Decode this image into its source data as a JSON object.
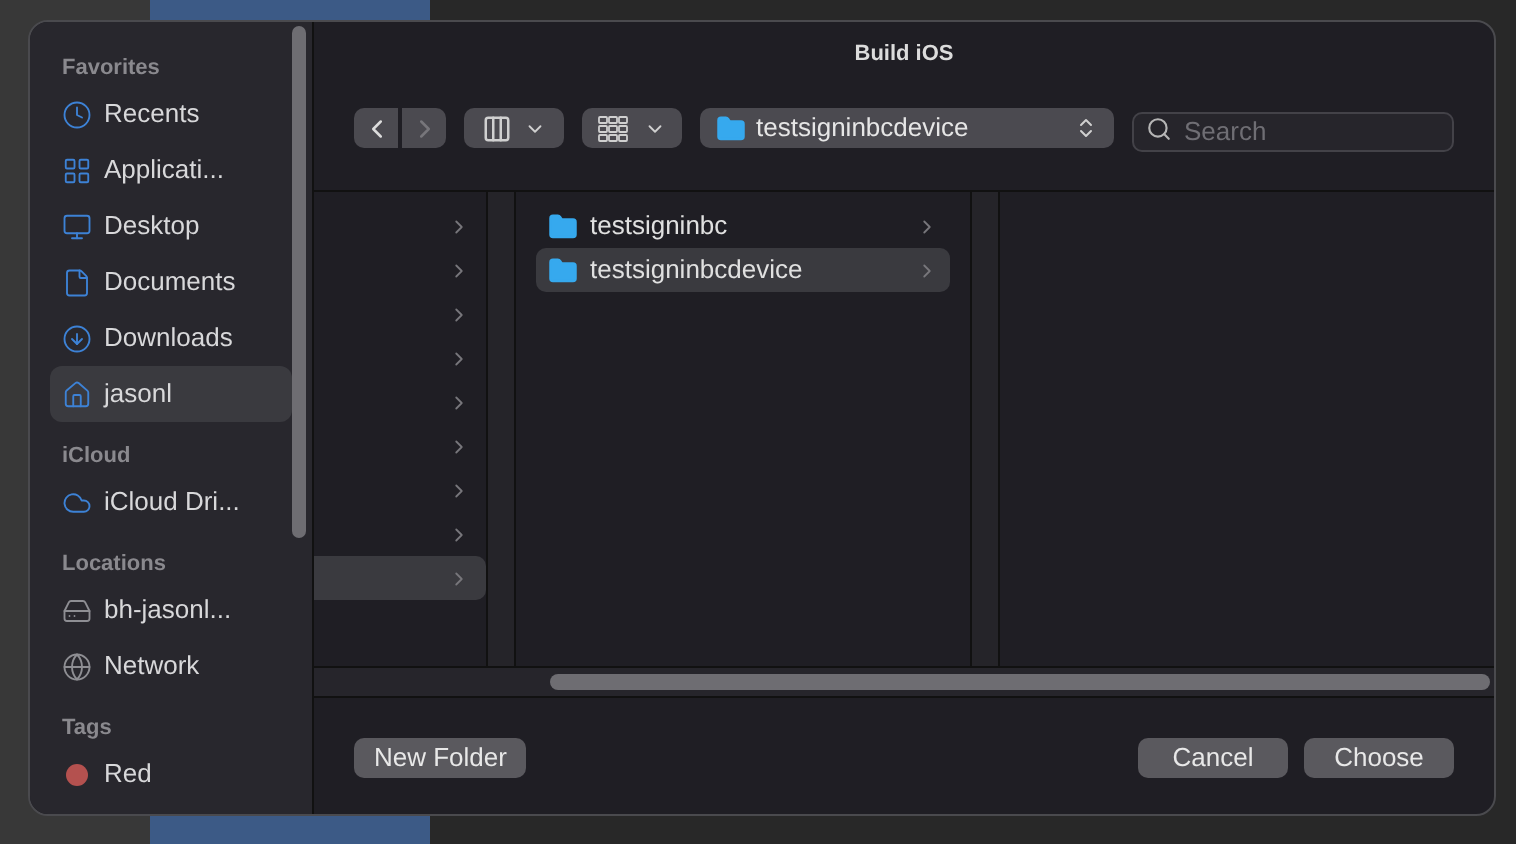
{
  "window": {
    "title": "Build iOS"
  },
  "sidebar": {
    "sections": [
      {
        "heading": "Favorites",
        "items": [
          {
            "label": "Recents",
            "kind": "clock",
            "selected": false
          },
          {
            "label": "Applicati...",
            "kind": "apps",
            "selected": false
          },
          {
            "label": "Desktop",
            "kind": "desktop",
            "selected": false
          },
          {
            "label": "Documents",
            "kind": "document",
            "selected": false
          },
          {
            "label": "Downloads",
            "kind": "download",
            "selected": false
          },
          {
            "label": "jasonl",
            "kind": "home",
            "selected": true
          }
        ]
      },
      {
        "heading": "iCloud",
        "items": [
          {
            "label": "iCloud Dri...",
            "kind": "cloud",
            "selected": false
          }
        ]
      },
      {
        "heading": "Locations",
        "items": [
          {
            "label": "bh-jasonl...",
            "kind": "drive",
            "selected": false
          },
          {
            "label": "Network",
            "kind": "globe",
            "selected": false
          }
        ]
      },
      {
        "heading": "Tags",
        "items": [
          {
            "label": "Red",
            "kind": "tag",
            "color": "#b4514f",
            "selected": false
          }
        ]
      }
    ]
  },
  "toolbar": {
    "back": {
      "disabled": false
    },
    "forward": {
      "disabled": true
    },
    "path": "testsigninbcdevice",
    "search": {
      "placeholder": "Search"
    }
  },
  "columns": {
    "column_1": [
      {
        "selected": false
      },
      {
        "selected": false
      },
      {
        "selected": false
      },
      {
        "selected": false
      },
      {
        "selected": false
      },
      {
        "selected": false
      },
      {
        "selected": false
      },
      {
        "selected": false
      },
      {
        "selected": true
      }
    ],
    "column_2": [
      {
        "name": "testsigninbc",
        "selected": false
      },
      {
        "name": "testsigninbcdevice",
        "selected": true
      }
    ]
  },
  "buttons": {
    "new_folder": "New Folder",
    "cancel": "Cancel",
    "choose": "Choose"
  }
}
